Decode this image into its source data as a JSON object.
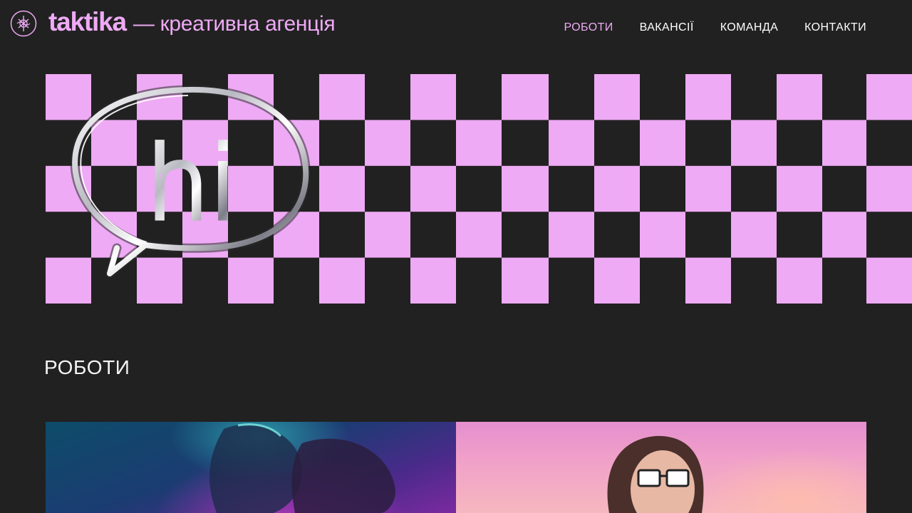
{
  "header": {
    "logo_icon": "taktika-emblem-icon",
    "brand_name": "taktika",
    "tagline": "— креативна агенція",
    "accent_color": "#eeaaf4"
  },
  "nav": {
    "items": [
      {
        "label": "РОБОТИ",
        "active": true
      },
      {
        "label": "ВАКАНСІЇ",
        "active": false
      },
      {
        "label": "КОМАНДА",
        "active": false
      },
      {
        "label": "КОНТАКТИ",
        "active": false
      }
    ]
  },
  "hero": {
    "bubble_text": "hi",
    "checker_color": "#eeaaf4",
    "background_color": "#212121"
  },
  "works_section": {
    "title": "РОБОТИ",
    "cards": [
      {
        "image": "neon-portrait-kiss-image"
      },
      {
        "image": "man-with-sunglasses-pink-sky-image"
      }
    ]
  }
}
